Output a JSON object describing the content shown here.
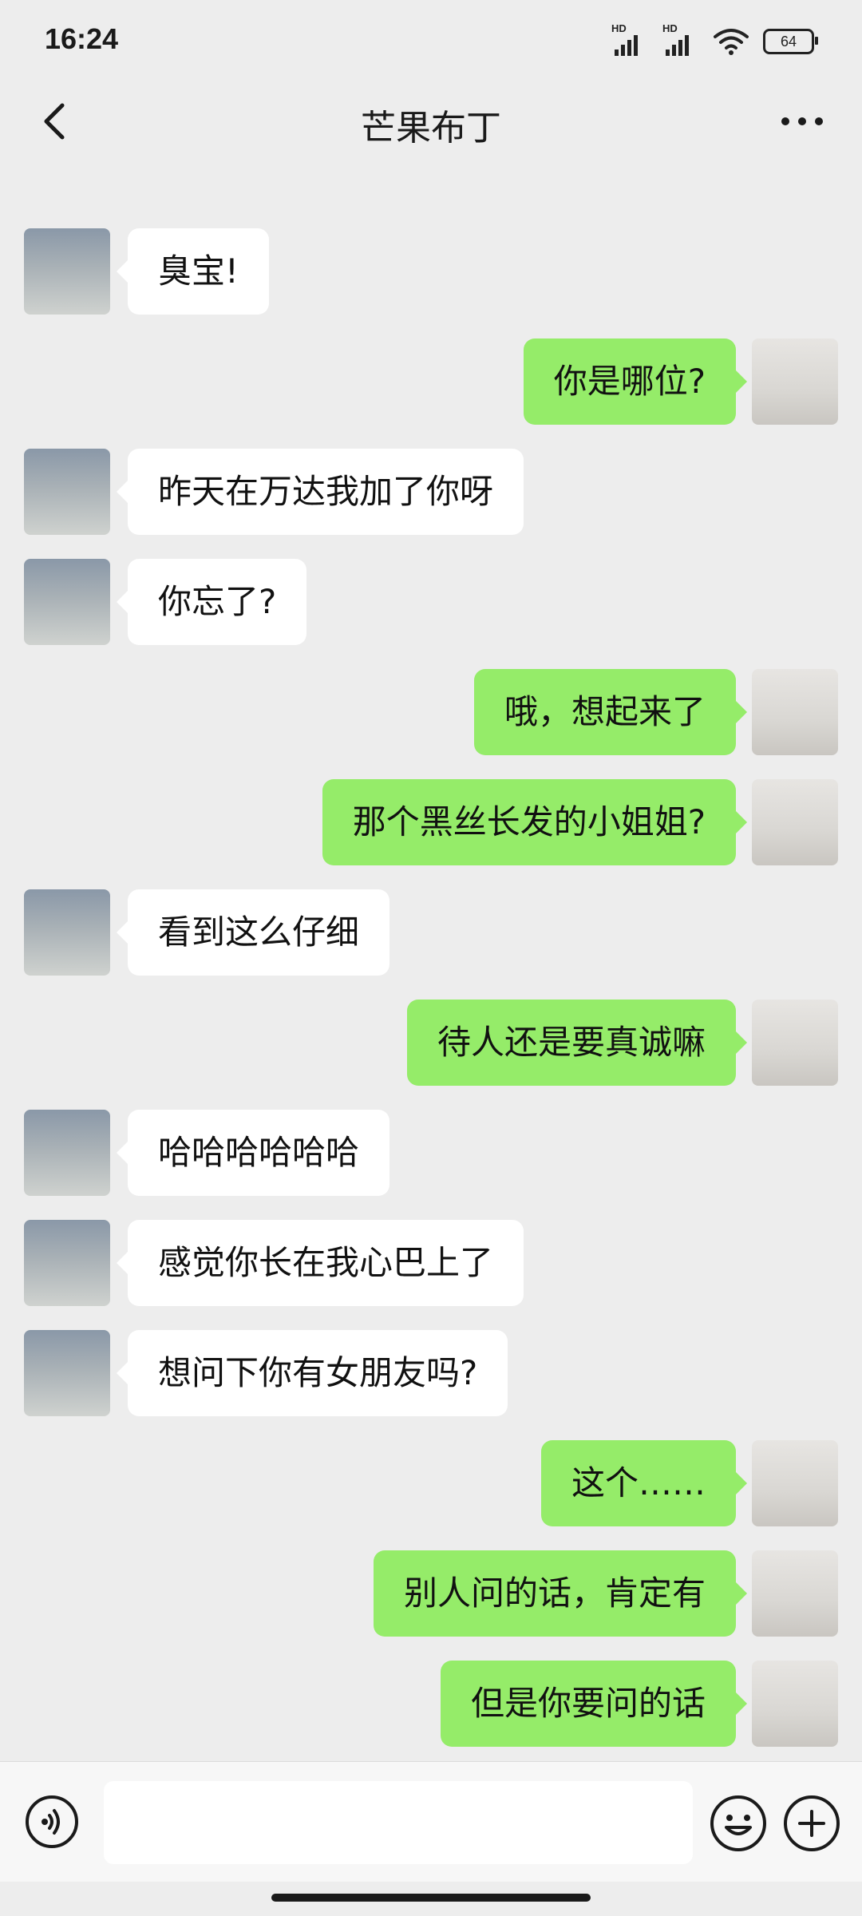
{
  "status_bar": {
    "time": "16:24",
    "signal1_label": "HD",
    "signal2_label": "HD",
    "wifi_icon": "wifi-icon",
    "battery_level": "64"
  },
  "header": {
    "title": "芒果布丁",
    "back_icon": "back-chevron-icon",
    "more_icon": "more-dots-icon"
  },
  "messages": [
    {
      "side": "left",
      "text": "臭宝!"
    },
    {
      "side": "right",
      "text": "你是哪位?"
    },
    {
      "side": "left",
      "text": "昨天在万达我加了你呀"
    },
    {
      "side": "left",
      "text": "你忘了?"
    },
    {
      "side": "right",
      "text": "哦，想起来了"
    },
    {
      "side": "right",
      "text": "那个黑丝长发的小姐姐?"
    },
    {
      "side": "left",
      "text": "看到这么仔细"
    },
    {
      "side": "right",
      "text": "待人还是要真诚嘛"
    },
    {
      "side": "left",
      "text": "哈哈哈哈哈哈"
    },
    {
      "side": "left",
      "text": "感觉你长在我心巴上了"
    },
    {
      "side": "left",
      "text": "想问下你有女朋友吗?"
    },
    {
      "side": "right",
      "text": "这个……"
    },
    {
      "side": "right",
      "text": "别人问的话，肯定有"
    },
    {
      "side": "right",
      "text": "但是你要问的话"
    }
  ],
  "input_bar": {
    "voice_icon": "voice-icon",
    "text_value": "",
    "emoji_icon": "emoji-icon",
    "plus_icon": "plus-icon"
  },
  "colors": {
    "background": "#ededed",
    "incoming_bubble": "#ffffff",
    "outgoing_bubble": "#95ec69"
  }
}
